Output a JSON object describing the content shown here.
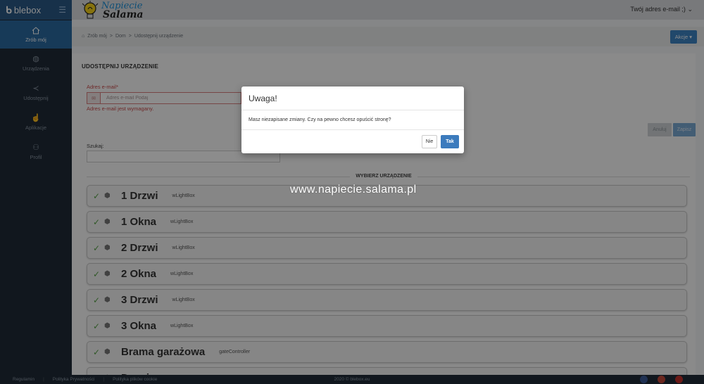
{
  "sidebar": {
    "logo": "blebox",
    "items": [
      {
        "label": "Zrób mój",
        "icon": "home-icon"
      },
      {
        "label": "Urządzenia",
        "icon": "devices-icon"
      },
      {
        "label": "Udostępnij",
        "icon": "share-icon"
      },
      {
        "label": "Aplikacje",
        "icon": "apps-icon"
      },
      {
        "label": "Profil",
        "icon": "user-icon"
      }
    ]
  },
  "topbar": {
    "brand_line1": "Napiecie",
    "brand_line2": "Salama",
    "user_menu": "Twój adres e-mail ;)"
  },
  "breadcrumb": {
    "items": [
      "Zrób mój",
      "Dom",
      "Udostępnij urządzenie"
    ],
    "actions_label": "Akcje"
  },
  "form": {
    "title": "UDOSTĘPNIJ URZĄDZENIE",
    "email_label": "Adres e-mail*",
    "email_placeholder": "Adres e-mail Podaj",
    "email_error": "Adres e-mail jest wymagany.",
    "cancel_label": "Anuluj",
    "save_label": "Zapisz",
    "search_label": "Szukaj:",
    "section_title": "WYBIERZ URZĄDZENIE"
  },
  "devices": [
    {
      "name": "1 Drzwi",
      "type": "wLightBox"
    },
    {
      "name": "1 Okna",
      "type": "wLightBox"
    },
    {
      "name": "2 Drzwi",
      "type": "wLightBox"
    },
    {
      "name": "2 Okna",
      "type": "wLightBox"
    },
    {
      "name": "3 Drzwi",
      "type": "wLightBox"
    },
    {
      "name": "3 Okna",
      "type": "wLightBox"
    },
    {
      "name": "Brama garażowa",
      "type": "gateController"
    },
    {
      "name": "Drzwi",
      "type": ""
    }
  ],
  "watermark": "www.napiecie.salama.pl",
  "footer": {
    "links": [
      "Regulamin",
      "Polityka Prywatności",
      "Polityka plików cookie"
    ],
    "copyright": "2020 © blebox.eu"
  },
  "modal": {
    "title": "Uwaga!",
    "message": "Masz niezapisane zmiany. Czy na pewno chcesz opuścić stronę?",
    "no_label": "Nie",
    "yes_label": "Tak"
  },
  "colors": {
    "accent": "#3c83c4",
    "sidebar": "#1f2b38",
    "error": "#c94c4c",
    "check": "#5aa24a"
  }
}
